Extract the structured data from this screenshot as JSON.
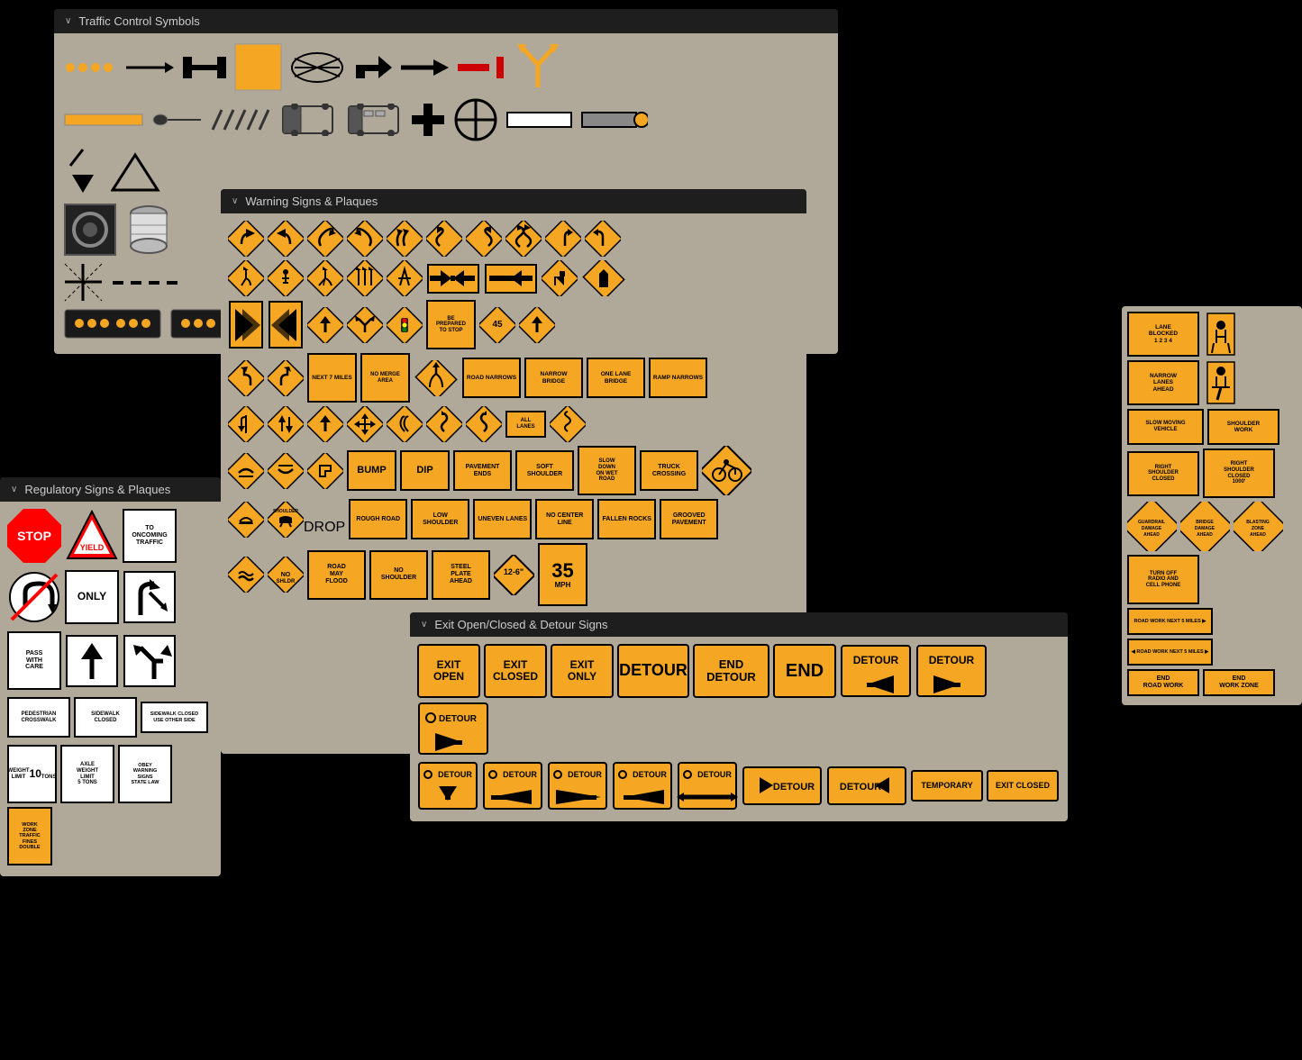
{
  "panels": {
    "traffic_control": {
      "title": "Traffic Control Symbols",
      "chevron": "∨"
    },
    "warning": {
      "title": "Warning Signs & Plaques",
      "chevron": "∨"
    },
    "regulatory": {
      "title": "Regulatory Signs & Plaques",
      "chevron": "∨"
    },
    "exit": {
      "title": "Exit Open/Closed & Detour Signs",
      "chevron": "∨"
    }
  },
  "warning_signs": {
    "row1": [
      "curve-left",
      "curve-right",
      "curve-left2",
      "curve-right2",
      "curve-left3",
      "reverse-left",
      "reverse-right",
      "reverse-left2",
      "reverse-right2",
      "winding"
    ],
    "text_signs": {
      "next_miles": "NEXT\n7 MILES",
      "no_merge": "NO\nMERGE\nAREA",
      "road_narrows": "ROAD\nNARROWS",
      "narrow_bridge": "NARROW\nBRIDGE",
      "one_lane": "ONE LANE\nBRIDGE",
      "ramp_narrows": "RAMP\nNARROWS",
      "bump": "BUMP",
      "dip": "DIP",
      "pavement_ends": "PAVEMENT\nENDS",
      "soft_shoulder": "SOFT\nSHOULDER",
      "slow_down": "SLOW\nDOWN\nON WET\nROAD",
      "truck_crossing": "TRUCK\nCROSSING",
      "rough_road": "ROUGH\nROAD",
      "low_shoulder": "LOW\nSHOULDER",
      "uneven_lanes": "UNEVEN\nLANES",
      "no_center_line": "NO\nCENTER\nLINE",
      "fallen_rocks": "FALLEN\nROCKS",
      "grooved_pavement": "GROOVED\nPAVEMENT",
      "road_may_flood": "ROAD\nMAY\nFLOOD",
      "no_shoulder": "NO\nSHOULDER",
      "steel_plate": "STEEL\nPLATE\nAHEAD",
      "speed_35": "35\nMPH"
    }
  },
  "regulatory_signs": {
    "stop": "STOP",
    "yield_text": "YIELD",
    "to_oncoming": "TO\nONCOMING\nTRAFFIC",
    "pass_with_care": "PASS\nWITH\nCARE",
    "only": "ONLY",
    "pedestrian_crosswalk": "PEDESTRIAN\nCROSSWALK",
    "sidewalk_closed": "SIDEWALK\nCLOSED",
    "sidewalk_closed_use_other": "SIDEWALK CLOSED\nUSE OTHER SIDE",
    "weight_limit": "WEIGHT\nLIMIT\n10\nTONS",
    "axle_weight": "AXLE\nWEIGHT\nLIMIT\n5 TONS",
    "obey_warning": "OBEY\nWARNING\nSIGNS\nSTATE LAW",
    "work_zone": "WORK\nZONE\nTRAFFIC\nFINES DOUBLE"
  },
  "exit_signs": {
    "exit_open": "EXIT\nOPEN",
    "exit_closed": "EXIT\nCLOSED",
    "exit_only": "EXIT\nONLY",
    "detour": "DETOUR",
    "end_detour": "END\nDETOUR",
    "end": "END",
    "temporary": "TEMPORARY",
    "exit_closed2": "EXIT CLOSED"
  },
  "rightside_labels": {
    "lane_blocked": "LANE\nBLOCKED\n1 2 3 4",
    "narrow_lanes": "NARROW\nLANES\nAHEAD",
    "slow_moving": "SLOW MOVING\nVEHICLE",
    "shoulder_work": "SHOULDER\nWORK",
    "right_shoulder_closed": "RIGHT\nSHOULDER\nCLOSED",
    "right_shoulder_closed2": "RIGHT\nSHOULDER\nCLOSED\n1000'",
    "turn_off": "TURN OFF\nRADIO AND\nCELL PHONE",
    "end_road_work": "END\nROAD WORK",
    "end_work_zone": "END\nWORK ZONE",
    "road_work_miles1": "ROAD WORK\nNEXT 5 MILES ▶",
    "road_work_miles2": "ROAD WORK\n◀ NEXT 5 MILES ▶"
  },
  "colors": {
    "orange": "#f5a623",
    "dark_orange": "#e09000",
    "panel_bg": "#2a2a2a",
    "panel_header": "#1e1e1e",
    "sign_bg": "#b0a898",
    "text_dark": "#ccc",
    "red": "#cc0000",
    "white": "#ffffff",
    "black": "#000000"
  }
}
